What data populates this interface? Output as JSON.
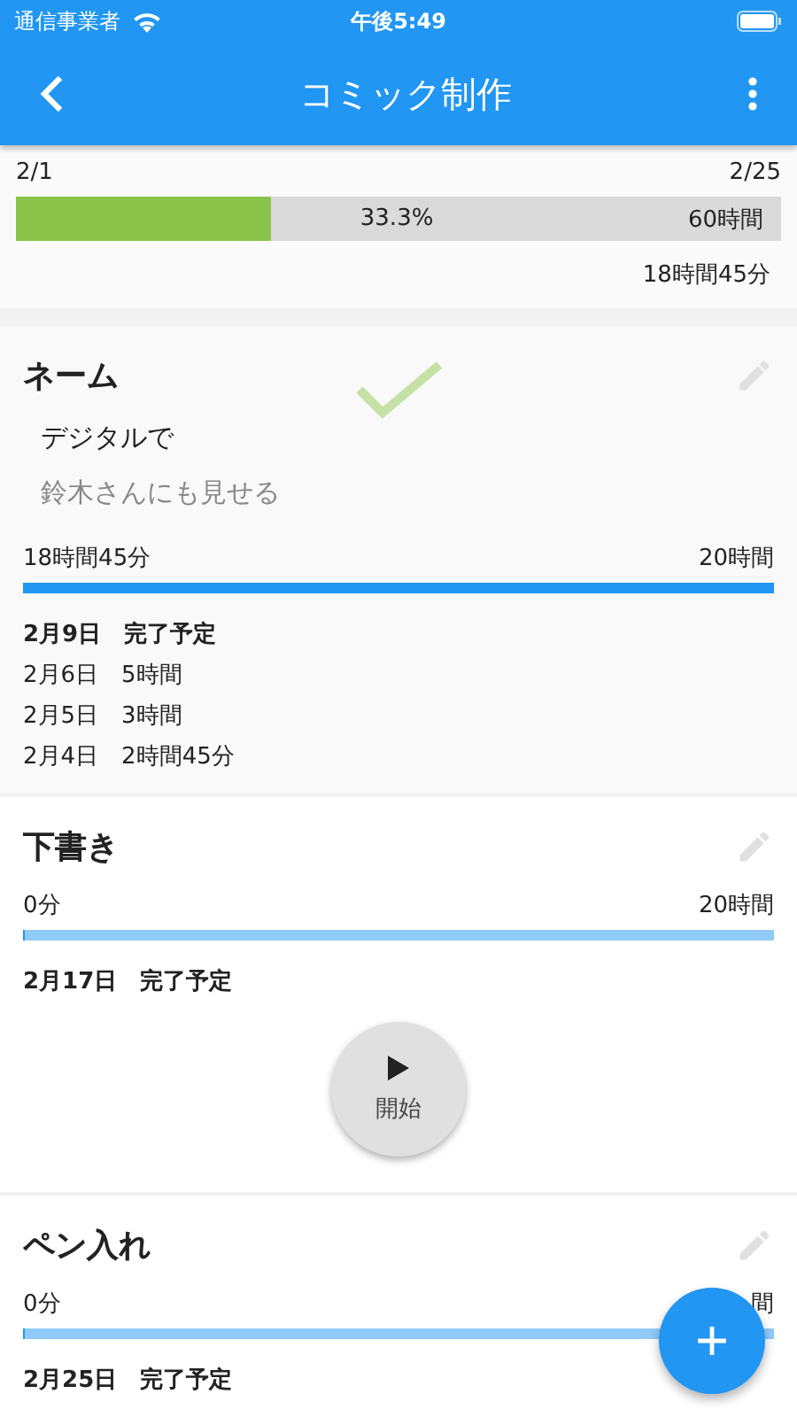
{
  "status_bar": {
    "carrier": "通信事業者",
    "time": "午後5:49"
  },
  "app_bar": {
    "title": "コミック制作"
  },
  "overview": {
    "start_date": "2/1",
    "end_date": "2/25",
    "level": 0.333,
    "percent": "33.3%",
    "total": "60時間",
    "spent": "18時間45分"
  },
  "tasks": [
    {
      "title": "ネーム",
      "done": true,
      "notes": [
        {
          "text": "デジタルで",
          "checked": false
        },
        {
          "text": "鈴木さんにも見せる",
          "checked": true
        }
      ],
      "spent": "18時間45分",
      "goal": "20時間",
      "level": 1,
      "schedule": {
        "date": "2月9日",
        "label": "完了予定"
      },
      "log": [
        {
          "date": "2月6日",
          "amount": "5時間"
        },
        {
          "date": "2月5日",
          "amount": "3時間"
        },
        {
          "date": "2月4日",
          "amount": "2時間45分"
        }
      ]
    },
    {
      "title": "下書き",
      "done": false,
      "spent": "0分",
      "goal": "20時間",
      "level": 0,
      "schedule": {
        "date": "2月17日",
        "label": "完了予定"
      },
      "start_button": "開始"
    },
    {
      "title": "ペン入れ",
      "done": false,
      "spent": "0分",
      "goal": "間",
      "level": 0,
      "schedule": {
        "date": "2月25日",
        "label": "完了予定"
      }
    }
  ]
}
